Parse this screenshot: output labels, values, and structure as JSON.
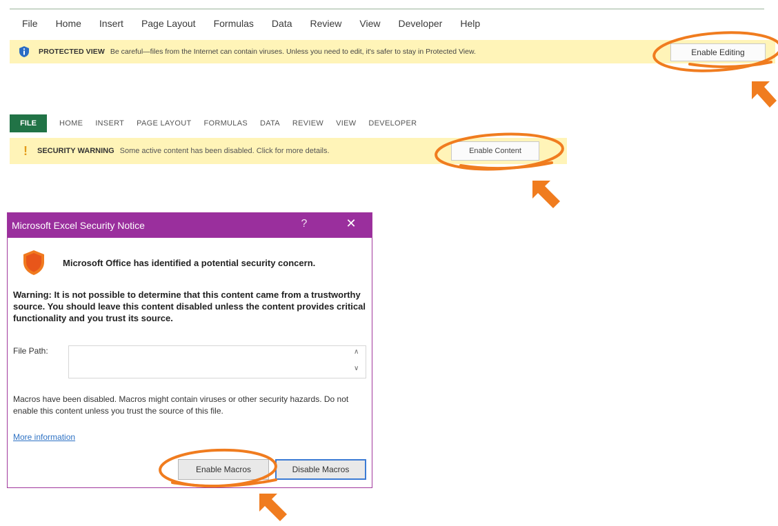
{
  "protected_view": {
    "ribbon_tabs": [
      "File",
      "Home",
      "Insert",
      "Page Layout",
      "Formulas",
      "Data",
      "Review",
      "View",
      "Developer",
      "Help"
    ],
    "icon": "shield-info-icon",
    "title": "PROTECTED VIEW",
    "message": "Be careful—files from the Internet can contain viruses. Unless you need to edit, it's safer to stay in Protected View.",
    "button": "Enable Editing",
    "bar_color": "#fff4b8"
  },
  "security_warning": {
    "file_tab": "FILE",
    "ribbon_tabs": [
      "HOME",
      "INSERT",
      "PAGE LAYOUT",
      "FORMULAS",
      "DATA",
      "REVIEW",
      "VIEW",
      "DEVELOPER"
    ],
    "icon": "exclamation-icon",
    "title": "SECURITY WARNING",
    "message": "Some active content has been disabled. Click for more details.",
    "button": "Enable Content",
    "file_tab_color": "#217346"
  },
  "dialog": {
    "title": "Microsoft Excel Security Notice",
    "help": "?",
    "close": "✕",
    "icon": "warning-shield-icon",
    "headline": "Microsoft Office has identified a potential security concern.",
    "warning": "Warning: It is not possible to determine that this content came from a trustworthy source. You should leave this content disabled unless the content provides critical functionality and you trust its source.",
    "file_path_label": "File Path:",
    "file_path_value": "",
    "macros_text": "Macros have been disabled. Macros might contain viruses or other security hazards. Do not enable this content unless you trust the source of this file.",
    "more_info": "More information",
    "enable_button": "Enable Macros",
    "disable_button": "Disable Macros",
    "titlebar_color": "#9a2f9d"
  },
  "annotations": {
    "highlight_color": "#f07c1f",
    "icons": [
      "highlight-circle",
      "pointer-arrow-icon"
    ]
  }
}
